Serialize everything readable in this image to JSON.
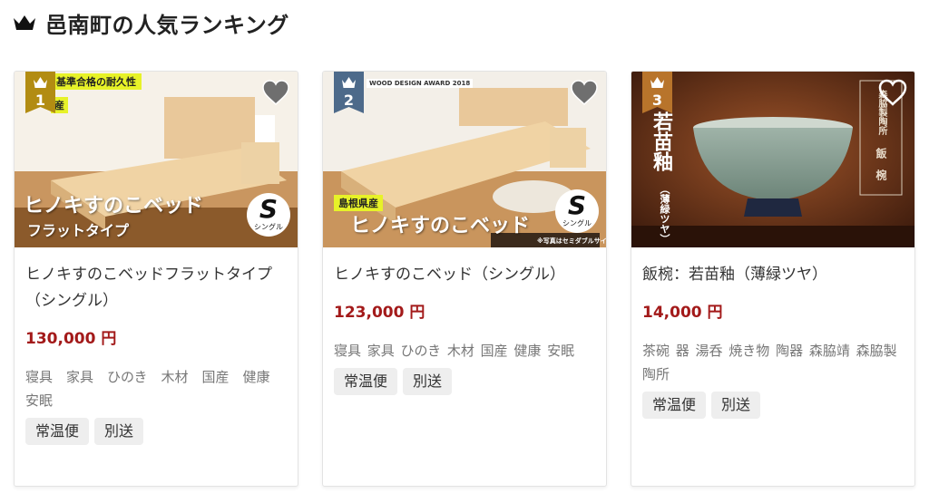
{
  "section": {
    "title": "邑南町の人気ランキング",
    "icon": "crown-icon"
  },
  "colors": {
    "rank1": "#b28c12",
    "rank2": "#4d6a8a",
    "rank3": "#b8742b",
    "price": "#a31a1a"
  },
  "cards": [
    {
      "rank": "1",
      "title": "ヒノキすのこベッドフラットタイプ（シングル）",
      "price": "130,000 円",
      "tags": "寝具　家具　ひのき　木材　国産　健康　安眠",
      "shipping": [
        "常温便",
        "別送"
      ],
      "image_text": {
        "banner": "基準合格の耐久性",
        "banner2": "産",
        "main": "ヒノキすのこベッド",
        "sub": "フラットタイプ",
        "s_badge": "S",
        "s_label": "シングル"
      }
    },
    {
      "rank": "2",
      "title": "ヒノキすのこベッド（シングル）",
      "price": "123,000 円",
      "tags": "寝具 家具 ひのき 木材 国産 健康 安眠",
      "shipping": [
        "常温便",
        "別送"
      ],
      "image_text": {
        "badge": "島根県産",
        "main": "ヒノキすのこベッド",
        "s_badge": "S",
        "s_label": "シングル",
        "award": "WOOD DESIGN AWARD 2018",
        "note": "※写真はセミダブルサイズです"
      }
    },
    {
      "rank": "3",
      "title": "飯椀：若苗釉（薄緑ツヤ）",
      "price": "14,000 円",
      "tags": "茶碗 器 湯呑 焼き物 陶器 森脇靖 森脇製陶所",
      "shipping": [
        "常温便",
        "別送"
      ],
      "image_text": {
        "vertical_main": "若苗釉",
        "vertical_sub": "（薄緑ツヤ）",
        "maker": "森脇製陶所",
        "item": "飯椀"
      }
    }
  ]
}
